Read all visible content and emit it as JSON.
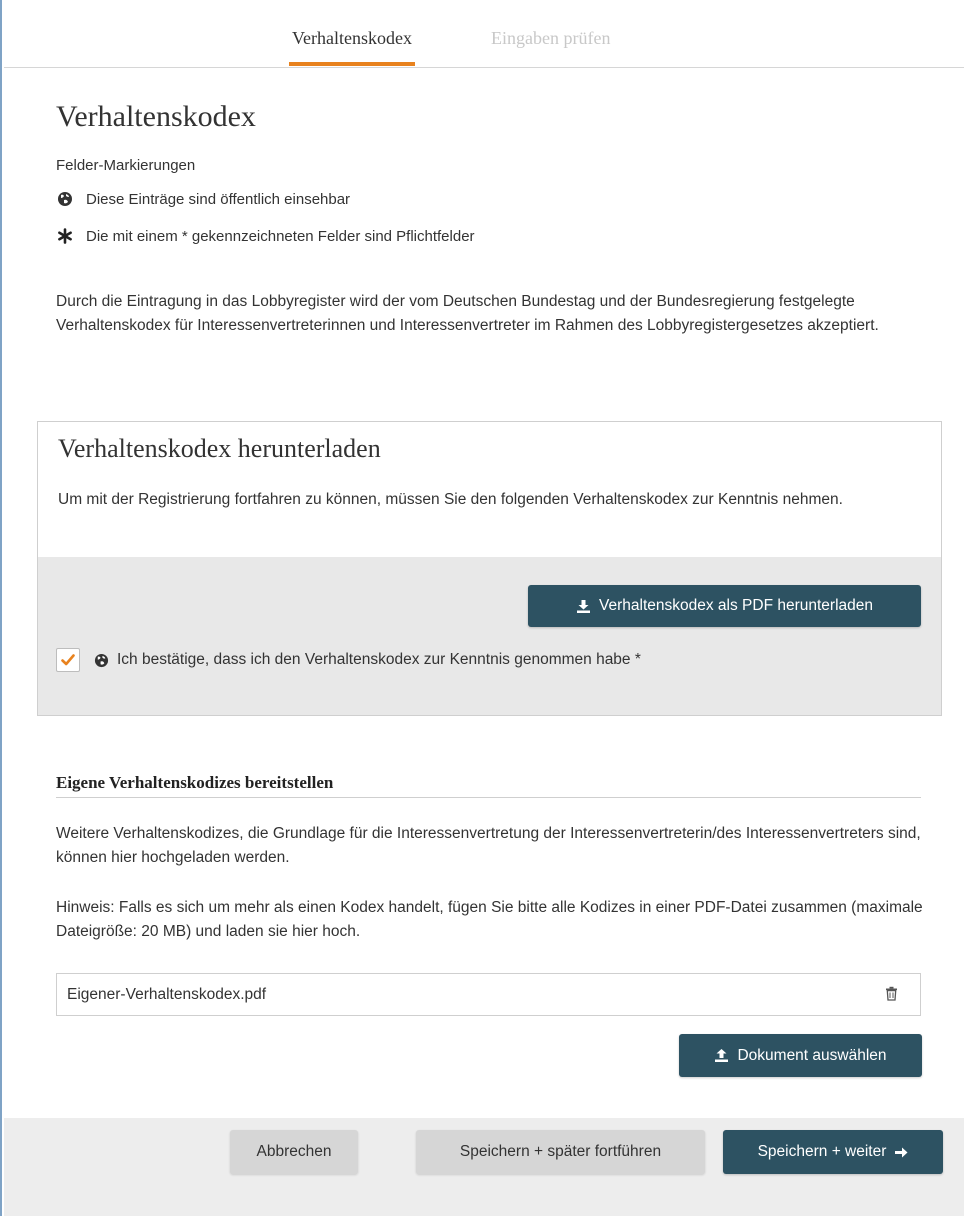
{
  "tabs": [
    {
      "label": "Verhaltenskodex",
      "active": true
    },
    {
      "label": "Eingaben prüfen",
      "active": false
    }
  ],
  "page_title": "Verhaltenskodex",
  "legend": {
    "title": "Felder-Markierungen",
    "public_label": "Diese Einträge sind öffentlich einsehbar",
    "public_icon": "globe-icon",
    "required_label": "Die mit einem * gekennzeichneten Felder sind Pflichtfelder",
    "required_icon": "asterisk-icon"
  },
  "intro_text": "Durch die Eintragung in das Lobbyregister wird der vom Deutschen Bundestag und der Bundesregierung festgelegte Verhaltenskodex für Interessenvertreterinnen und Interessenvertreter im Rahmen des Lobbyregistergesetzes akzeptiert.",
  "download_box": {
    "title": "Verhaltenskodex herunterladen",
    "text": "Um mit der Registrierung fortfahren zu können, müssen Sie den folgenden Verhaltenskodex zur Kenntnis nehmen.",
    "button_label": "Verhaltenskodex als PDF herunterladen",
    "button_icon": "download-icon",
    "confirm_label": "Ich bestätige, dass ich den Verhaltenskodex zur Kenntnis genommen habe *",
    "confirm_checked": true
  },
  "own_codes": {
    "title": "Eigene Verhaltenskodizes bereitstellen",
    "text1": "Weitere Verhaltenskodizes, die Grundlage für die Interessenvertretung der Interessenvertreterin/des Interessenvertreters sind, können hier hochgeladen werden.",
    "text2": "Hinweis: Falls es sich um mehr als einen Kodex handelt, fügen Sie bitte alle Kodizes in einer PDF-Datei zusammen (maximale Dateigröße: 20 MB) und laden sie hier hoch.",
    "file_name": "Eigener-Verhaltenskodex.pdf",
    "upload_button_label": "Dokument auswählen",
    "upload_icon": "upload-icon"
  },
  "footer": {
    "cancel_label": "Abbrechen",
    "save_later_label": "Speichern + später fortführen",
    "save_next_label": "Speichern + weiter"
  },
  "colors": {
    "accent": "#e8821e",
    "button_dark": "#2d5262",
    "button_grey": "#d6d6d6",
    "panel_grey": "#e8e8e8"
  }
}
